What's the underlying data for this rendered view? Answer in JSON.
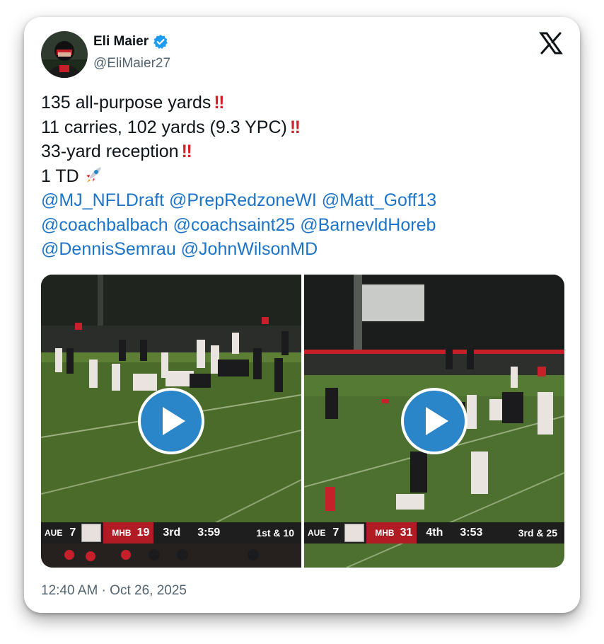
{
  "author": {
    "name": "Eli Maier",
    "handle": "@EliMaier27",
    "verified": true
  },
  "tweet": {
    "lines": [
      "135 all-purpose yards",
      "11 carries, 102 yards (9.3 YPC)",
      "33-yard reception",
      "1 TD"
    ],
    "emphasis": "‼",
    "mentions_lines": [
      "@MJ_NFLDraft @PrepRedzoneWI @Matt_Goff13",
      "@coachbalbach @coachsaint25 @BarnevldHoreb",
      "@DennisSemrau @JohnWilsonMD"
    ]
  },
  "videos": [
    {
      "scorebug": {
        "away_abbr": "AUE",
        "away_score": "7",
        "home_abbr": "MHB",
        "home_score": "19",
        "quarter": "3rd",
        "clock": "3:59",
        "down_distance": "1st & 10"
      }
    },
    {
      "scorebug": {
        "away_abbr": "AUE",
        "away_score": "7",
        "home_abbr": "MHB",
        "home_score": "31",
        "quarter": "4th",
        "clock": "3:53",
        "down_distance": "3rd & 25"
      }
    }
  ],
  "timestamp": "12:40 AM · Oct 26, 2025",
  "colors": {
    "mention": "#1d74c9",
    "emphasis": "#d4202a",
    "verified": "#1d9bf0",
    "play_button": "#2a85c9",
    "home_team": "#b01b24"
  },
  "icons": [
    "verified-badge-icon",
    "x-logo-icon",
    "rocket-icon",
    "play-icon"
  ]
}
